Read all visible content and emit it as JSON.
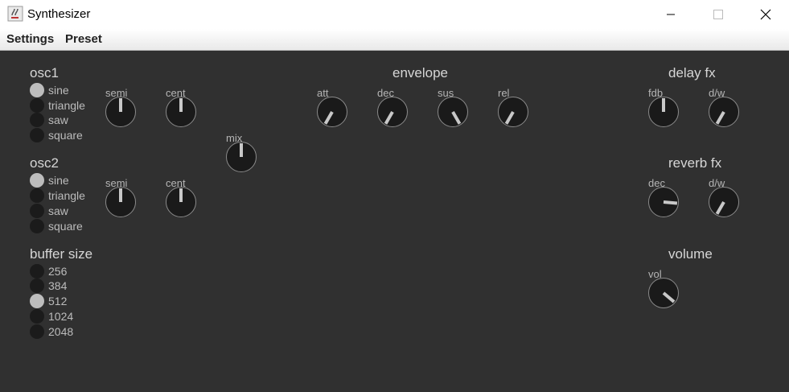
{
  "window": {
    "title": "Synthesizer",
    "icon": "java-coffee-cup-icon"
  },
  "menubar": {
    "items": [
      "Settings",
      "Preset"
    ]
  },
  "colors": {
    "panel_bg": "#303030",
    "knob_fill": "#1a1a1a",
    "indicator": "#c8c8c8",
    "text": "#d6d6d6",
    "radio_selected": "#bdbdbd",
    "radio_unselected": "#1b1b1b"
  },
  "osc1": {
    "title": "osc1",
    "waveforms": [
      "sine",
      "triangle",
      "saw",
      "square"
    ],
    "selected": "sine",
    "semi_label": "semi",
    "cent_label": "cent",
    "semi_angle_deg": 0,
    "cent_angle_deg": 0
  },
  "osc2": {
    "title": "osc2",
    "waveforms": [
      "sine",
      "triangle",
      "saw",
      "square"
    ],
    "selected": "sine",
    "semi_label": "semi",
    "cent_label": "cent",
    "semi_angle_deg": 0,
    "cent_angle_deg": 0
  },
  "mix": {
    "label": "mix",
    "angle_deg": 0
  },
  "buffer": {
    "title": "buffer size",
    "options": [
      "256",
      "384",
      "512",
      "1024",
      "2048"
    ],
    "selected": "512"
  },
  "envelope": {
    "title": "envelope",
    "att_label": "att",
    "dec_label": "dec",
    "sus_label": "sus",
    "rel_label": "rel",
    "att_angle_deg": -150,
    "dec_angle_deg": -150,
    "sus_angle_deg": 150,
    "rel_angle_deg": -150
  },
  "delay": {
    "title": "delay fx",
    "fdb_label": "fdb",
    "dw_label": "d/w",
    "fdb_angle_deg": 0,
    "dw_angle_deg": -150
  },
  "reverb": {
    "title": "reverb fx",
    "dec_label": "dec",
    "dw_label": "d/w",
    "dec_angle_deg": 95,
    "dw_angle_deg": -150
  },
  "volume": {
    "title": "volume",
    "vol_label": "vol",
    "vol_angle_deg": 130
  }
}
